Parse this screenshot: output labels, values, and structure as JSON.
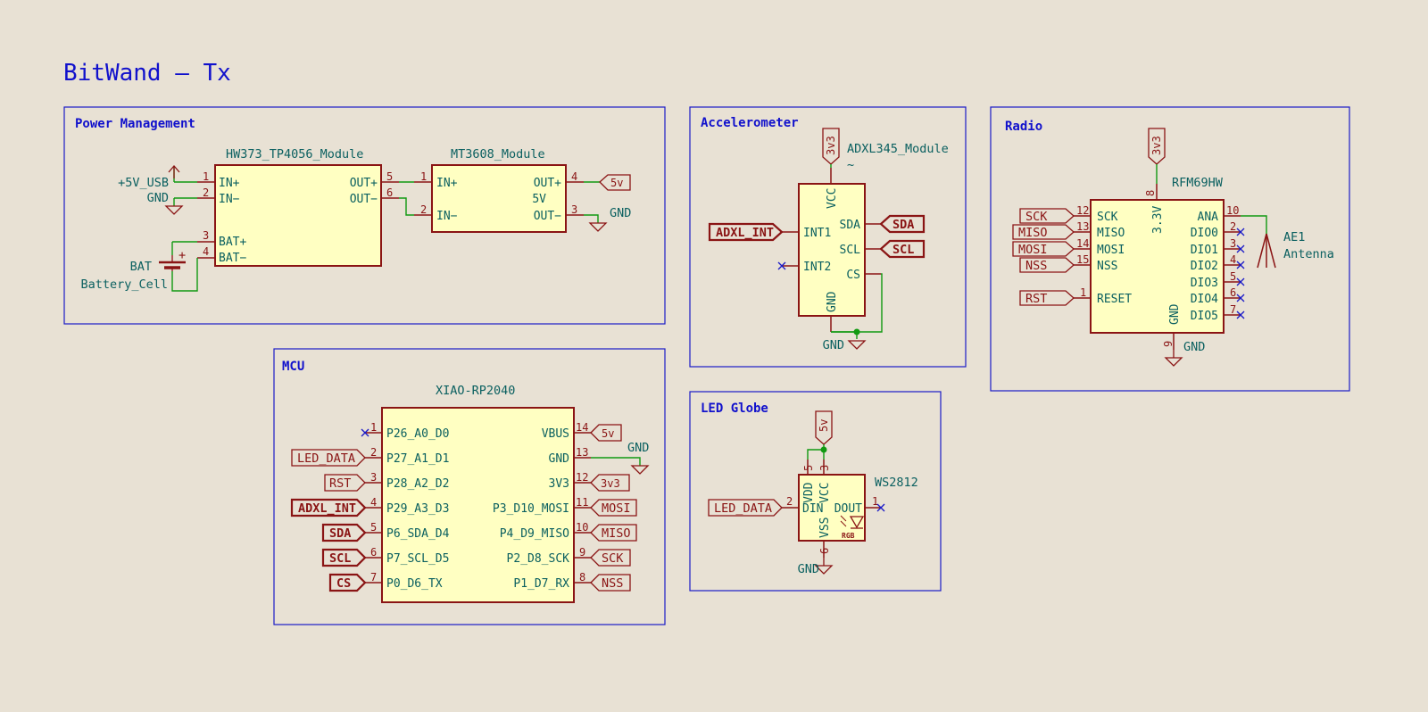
{
  "title": "BitWand — Tx",
  "sections": {
    "power": "Power Management",
    "accel": "Accelerometer",
    "radio": "Radio",
    "mcu": "MCU",
    "led": "LED Globe"
  },
  "power": {
    "tp4056": {
      "name": "HW373_TP4056_Module",
      "pins": [
        "IN+",
        "IN−",
        "BAT+",
        "BAT−",
        "OUT+",
        "OUT−"
      ],
      "nums": [
        "1",
        "2",
        "3",
        "4",
        "5",
        "6"
      ]
    },
    "mt3608": {
      "name": "MT3608_Module",
      "pins": [
        "IN+",
        "IN−",
        "OUT+",
        "5V",
        "OUT−"
      ],
      "nums": [
        "1",
        "2",
        "4",
        "3"
      ]
    },
    "usb": "+5V_USB",
    "gnd": "GND",
    "bat_ref": "BAT",
    "bat_val": "Battery_Cell",
    "bat_plus": "+",
    "out_5v": "5v"
  },
  "accel": {
    "name": "ADXL345_Module",
    "value": "~",
    "supply": "3v3",
    "pins": [
      "VCC",
      "SDA",
      "SCL",
      "INT1",
      "INT2",
      "CS",
      "GND"
    ],
    "labels": {
      "int1": "ADXL_INT",
      "sda": "SDA",
      "scl": "SCL"
    },
    "gnd": "GND"
  },
  "radio": {
    "name": "RFM69HW",
    "supply": "3v3",
    "pin_top": "3.3V",
    "pin_top_num": "8",
    "left_pins": [
      {
        "label": "SCK",
        "pin": "SCK",
        "num": "12"
      },
      {
        "label": "MISO",
        "pin": "MISO",
        "num": "13"
      },
      {
        "label": "MOSI",
        "pin": "MOSI",
        "num": "14"
      },
      {
        "label": "NSS",
        "pin": "NSS",
        "num": "15"
      },
      {
        "label": "RST",
        "pin": "RESET",
        "num": "1"
      }
    ],
    "right_pins": [
      {
        "pin": "ANA",
        "num": "10"
      },
      {
        "pin": "DIO0",
        "num": "2"
      },
      {
        "pin": "DIO1",
        "num": "3"
      },
      {
        "pin": "DIO2",
        "num": "4"
      },
      {
        "pin": "DIO3",
        "num": "5"
      },
      {
        "pin": "DIO4",
        "num": "6"
      },
      {
        "pin": "DIO5",
        "num": "7"
      }
    ],
    "gnd_pin": "GND",
    "gnd_num": "9",
    "gnd": "GND",
    "antenna_ref": "AE1",
    "antenna_val": "Antenna"
  },
  "mcu": {
    "name": "XIAO-RP2040",
    "left_pins": [
      {
        "label": "",
        "pin": "P26_A0_D0",
        "num": "1",
        "bold": false
      },
      {
        "label": "LED_DATA",
        "pin": "P27_A1_D1",
        "num": "2",
        "bold": false
      },
      {
        "label": "RST",
        "pin": "P28_A2_D2",
        "num": "3",
        "bold": false
      },
      {
        "label": "ADXL_INT",
        "pin": "P29_A3_D3",
        "num": "4",
        "bold": true
      },
      {
        "label": "SDA",
        "pin": "P6_SDA_D4",
        "num": "5",
        "bold": true
      },
      {
        "label": "SCL",
        "pin": "P7_SCL_D5",
        "num": "6",
        "bold": true
      },
      {
        "label": "CS",
        "pin": "P0_D6_TX",
        "num": "7",
        "bold": true
      }
    ],
    "right_pins": [
      {
        "label": "5v",
        "pin": "VBUS",
        "num": "14"
      },
      {
        "label": "",
        "pin": "GND",
        "num": "13"
      },
      {
        "label": "3v3",
        "pin": "3V3",
        "num": "12"
      },
      {
        "label": "MOSI",
        "pin": "P3_D10_MOSI",
        "num": "11"
      },
      {
        "label": "MISO",
        "pin": "P4_D9_MISO",
        "num": "10"
      },
      {
        "label": "SCK",
        "pin": "P2_D8_SCK",
        "num": "9"
      },
      {
        "label": "NSS",
        "pin": "P1_D7_RX",
        "num": "8"
      }
    ],
    "gnd": "GND"
  },
  "led": {
    "name": "WS2812",
    "supply": "5v",
    "in_label": "LED_DATA",
    "pins": [
      "VDD",
      "VCC",
      "DIN",
      "DOUT",
      "VSS"
    ],
    "nums": [
      "5",
      "3",
      "2",
      "1",
      "6"
    ],
    "rgb": "RGB",
    "gnd": "GND"
  }
}
